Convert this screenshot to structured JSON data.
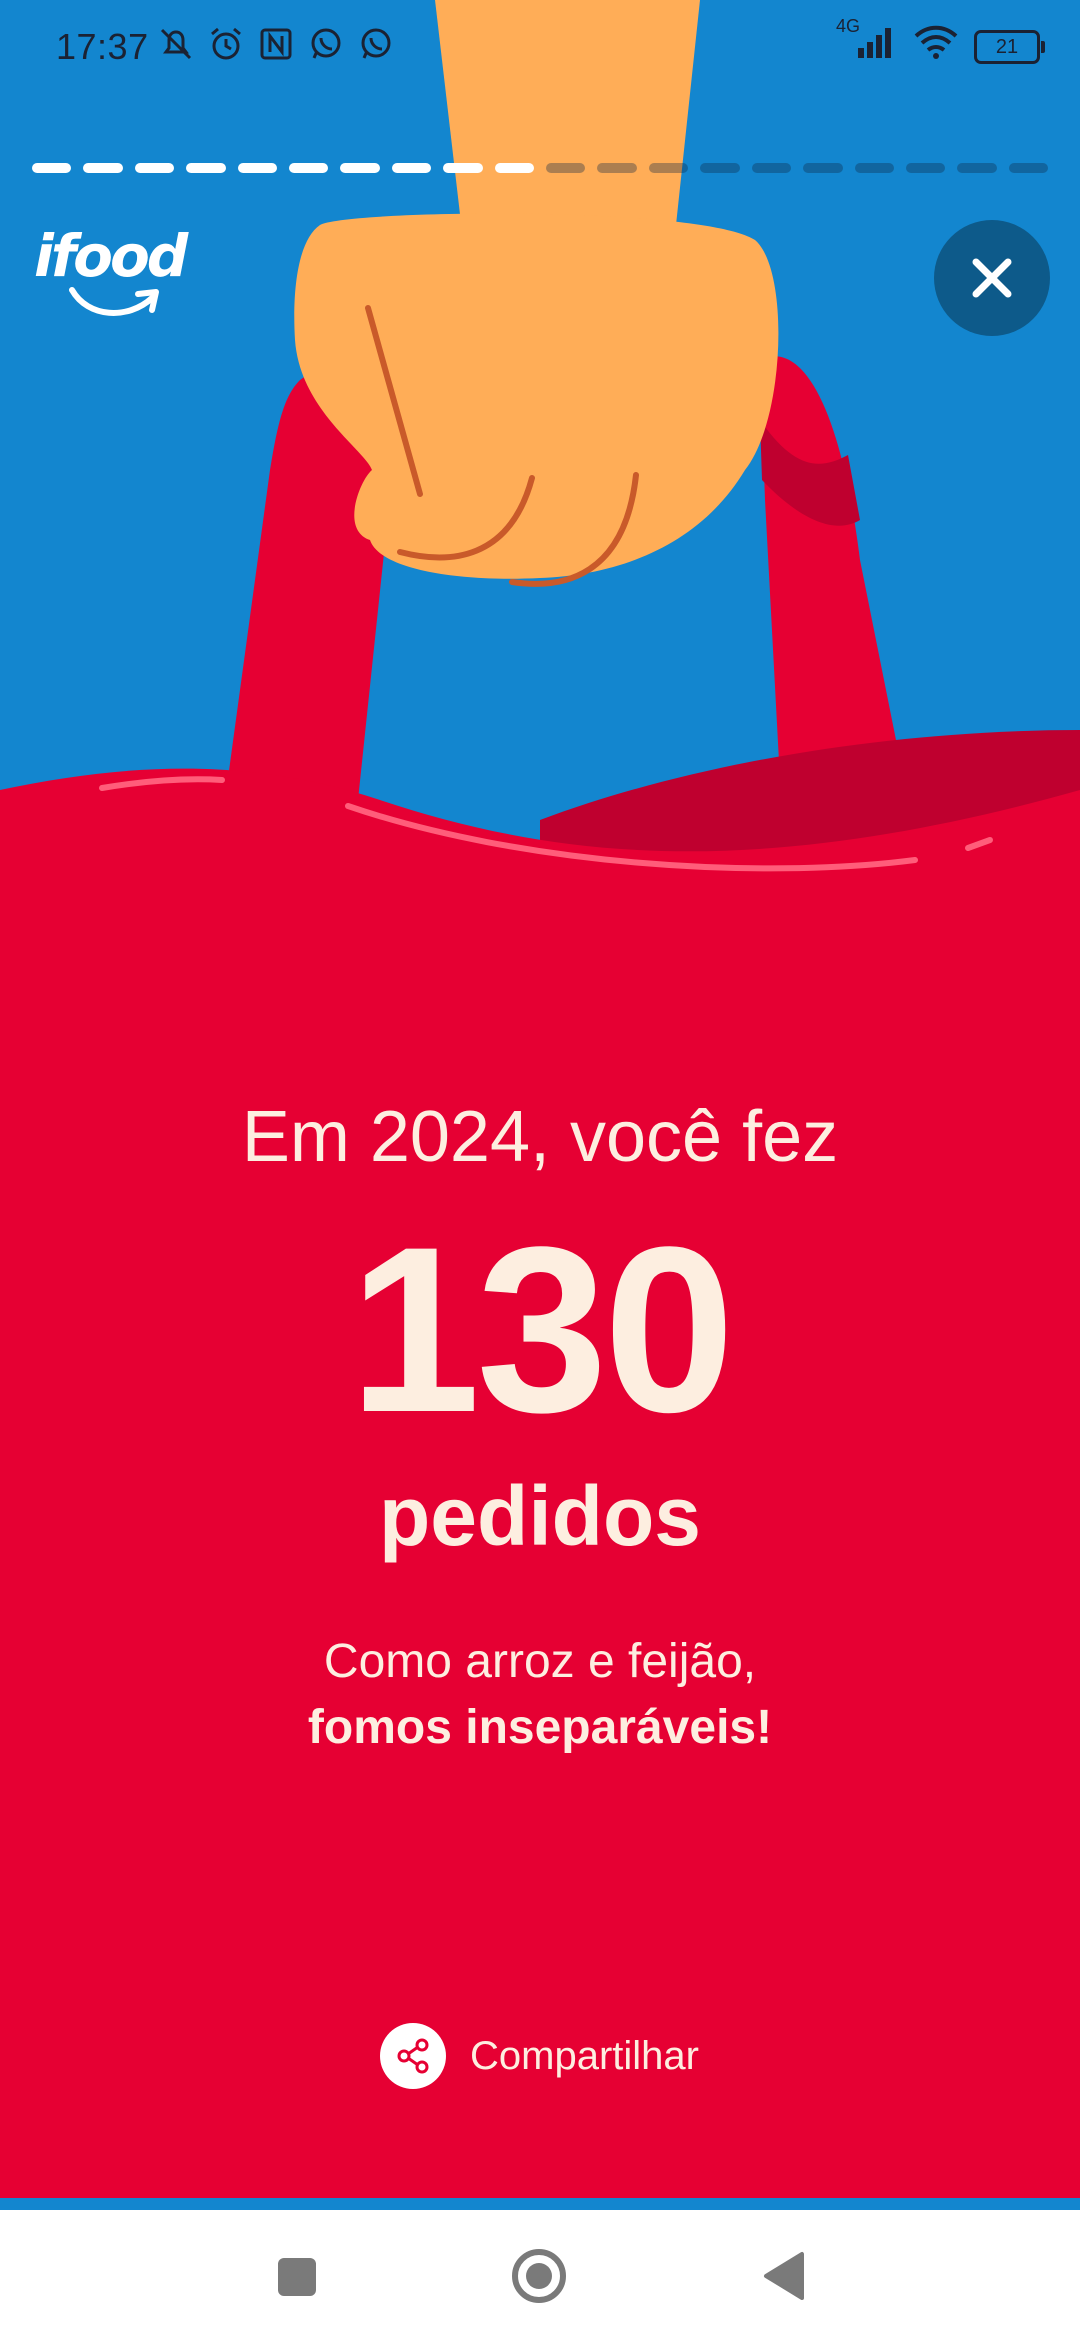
{
  "status_bar": {
    "time": "17:37",
    "network_label": "4G",
    "battery_level": "21",
    "left_icons": [
      "muted-bell-icon",
      "alarm-icon",
      "nfc-icon",
      "whatsapp-icon",
      "whatsapp-icon"
    ],
    "right_icons": [
      "signal-icon",
      "wifi-icon",
      "battery-icon"
    ]
  },
  "story": {
    "segments_total": 20,
    "segments_completed": 10
  },
  "header": {
    "logo_text": "ifood",
    "close_icon": "close-icon"
  },
  "content": {
    "headline": "Em 2024, você fez",
    "count": "130",
    "unit": "pedidos",
    "caption_line1": "Como arroz e feijão,",
    "caption_line2": "fomos inseparáveis!"
  },
  "share": {
    "label": "Compartilhar",
    "icon": "share-icon"
  },
  "nav": {
    "buttons": [
      "recent-apps",
      "home",
      "back"
    ]
  },
  "colors": {
    "sky": "#1386cf",
    "bag": "#e60033",
    "bag_shadow": "#bf002f",
    "hand": "#ffad57",
    "text": "#fdeee0",
    "close_bg": "#0d5a8a"
  }
}
